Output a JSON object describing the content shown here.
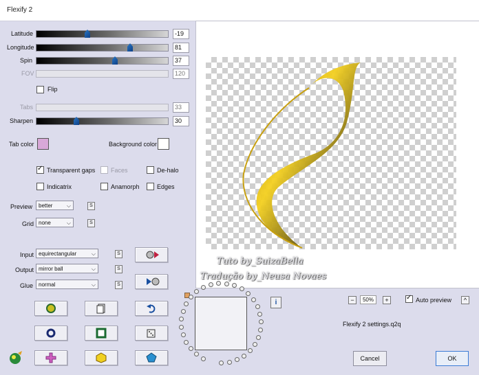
{
  "window": {
    "title": "Flexify 2"
  },
  "sliders": [
    {
      "label": "Latitude",
      "value": "-19",
      "pos": 0.38,
      "enabled": true
    },
    {
      "label": "Longitude",
      "value": "81",
      "pos": 0.7,
      "enabled": true
    },
    {
      "label": "Spin",
      "value": "37",
      "pos": 0.59,
      "enabled": true
    },
    {
      "label": "FOV",
      "value": "120",
      "pos": null,
      "enabled": false
    }
  ],
  "flip": {
    "label": "Flip",
    "checked": false
  },
  "sliders2": [
    {
      "label": "Tabs",
      "value": "33",
      "pos": null,
      "enabled": false
    },
    {
      "label": "Sharpen",
      "value": "30",
      "pos": 0.3,
      "enabled": true
    }
  ],
  "colors": {
    "tab_color_label": "Tab color",
    "tab_color": "#d8a8d8",
    "background_color_label": "Background color",
    "background_color": "#ffffff"
  },
  "options": {
    "transparent_gaps": "Transparent gaps",
    "faces": "Faces",
    "de_halo": "De-halo",
    "indicatrix": "Indicatrix",
    "anamorph": "Anamorph",
    "edges": "Edges"
  },
  "preview": {
    "label": "Preview",
    "value": "better"
  },
  "grid": {
    "label": "Grid",
    "value": "none"
  },
  "projection": {
    "input_label": "Input",
    "input_value": "equirectangular",
    "output_label": "Output",
    "output_value": "mirror ball",
    "glue_label": "Glue",
    "glue_value": "normal"
  },
  "watermark": {
    "line1": "Tuto by_SuizaBella",
    "line2": "Tradução by_Neusa Novaes"
  },
  "zoom": {
    "minus": "−",
    "value": "50%",
    "plus": "+"
  },
  "auto_preview": {
    "label": "Auto preview",
    "checked": true
  },
  "settings_file": "Flexify 2 settings.q2q",
  "buttons": {
    "cancel": "Cancel",
    "ok": "OK",
    "info": "i",
    "s": "S",
    "up": "^"
  },
  "icons": {
    "swap_in": "globe-arrow-icon",
    "swap_out": "arrow-globe-icon",
    "random": "dice-icon",
    "undo": "undo-icon",
    "copy": "copy-icon"
  }
}
